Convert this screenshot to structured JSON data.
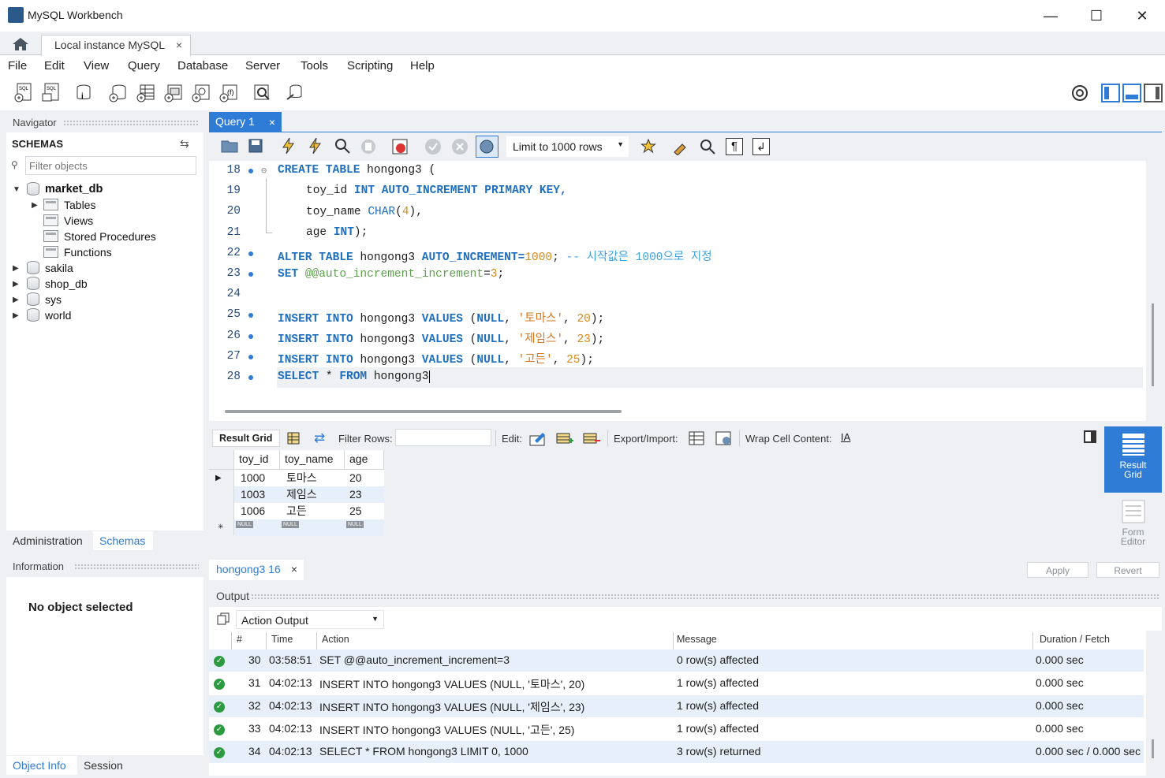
{
  "window": {
    "title": "MySQL Workbench",
    "minimize": "—",
    "maximize": "☐",
    "close": "✕"
  },
  "connection_tab": {
    "label": "Local instance MySQL",
    "close": "×"
  },
  "menu": [
    "File",
    "Edit",
    "View",
    "Query",
    "Database",
    "Server",
    "Tools",
    "Scripting",
    "Help"
  ],
  "navigator": {
    "title": "Navigator",
    "schemas_label": "SCHEMAS",
    "filter_placeholder": "Filter objects",
    "tree": {
      "db": "market_db",
      "children": [
        "Tables",
        "Views",
        "Stored Procedures",
        "Functions"
      ],
      "others": [
        "sakila",
        "shop_db",
        "sys",
        "world"
      ]
    },
    "tabs": [
      "Administration",
      "Schemas"
    ],
    "info_title": "Information",
    "no_object": "No object selected",
    "bottom_tabs": [
      "Object Info",
      "Session"
    ]
  },
  "query_tab": {
    "label": "Query 1",
    "close": "×"
  },
  "query_toolbar": {
    "limit": "Limit to 1000 rows"
  },
  "editor": {
    "lines": [
      {
        "n": "18",
        "dot": true
      },
      {
        "n": "19",
        "dot": false
      },
      {
        "n": "20",
        "dot": false
      },
      {
        "n": "21",
        "dot": false
      },
      {
        "n": "22",
        "dot": true
      },
      {
        "n": "23",
        "dot": true
      },
      {
        "n": "24",
        "dot": false
      },
      {
        "n": "25",
        "dot": true
      },
      {
        "n": "26",
        "dot": true
      },
      {
        "n": "27",
        "dot": true
      },
      {
        "n": "28",
        "dot": true
      }
    ],
    "tokens": {
      "create": "CREATE",
      "table": "TABLE",
      "hongong3": "hongong3",
      "paren_open": "(",
      "toy_id": "toy_id",
      "int": "INT",
      "auto_increment": "AUTO_INCREMENT",
      "primary_key": "PRIMARY KEY,",
      "toy_name": "toy_name",
      "char": "CHAR",
      "char_len": "4",
      "age": "age",
      "int_end": "INT",
      "alter": "ALTER",
      "auto_incr_eq": "AUTO_INCREMENT=",
      "start_val": "1000",
      "comment": "-- 시작값은 1000으로 지정",
      "set": "SET",
      "sysvar": "@@auto_increment_increment",
      "incr_val": "3",
      "insert": "INSERT",
      "into": "INTO",
      "values": "VALUES",
      "null": "NULL",
      "name1": "'토마스'",
      "age1": "20",
      "name2": "'제임스'",
      "age2": "23",
      "name3": "'고든'",
      "age3": "25",
      "select": "SELECT",
      "star": "*",
      "from": "FROM"
    }
  },
  "result_toolbar": {
    "result_grid": "Result Grid",
    "filter_rows": "Filter Rows:",
    "edit": "Edit:",
    "export_import": "Export/Import:",
    "wrap": "Wrap Cell Content:"
  },
  "grid": {
    "columns": [
      "toy_id",
      "toy_name",
      "age"
    ],
    "rows": [
      [
        "1000",
        "토마스",
        "20"
      ],
      [
        "1003",
        "제임스",
        "23"
      ],
      [
        "1006",
        "고든",
        "25"
      ]
    ],
    "null_label": "NULL"
  },
  "side_panel": {
    "result_grid": "Result Grid",
    "form_editor": "Form Editor"
  },
  "result_tab": {
    "label": "hongong3 16",
    "close": "×",
    "apply": "Apply",
    "revert": "Revert"
  },
  "output": {
    "title": "Output",
    "selector": "Action Output",
    "columns": [
      "#",
      "Time",
      "Action",
      "Message",
      "Duration / Fetch"
    ],
    "rows": [
      {
        "n": "30",
        "time": "03:58:51",
        "action": "SET @@auto_increment_increment=3",
        "message": "0 row(s) affected",
        "duration": "0.000 sec"
      },
      {
        "n": "31",
        "time": "04:02:13",
        "action": "INSERT INTO hongong3 VALUES (NULL, '토마스', 20)",
        "message": "1 row(s) affected",
        "duration": "0.000 sec"
      },
      {
        "n": "32",
        "time": "04:02:13",
        "action": "INSERT INTO hongong3 VALUES (NULL, '제임스', 23)",
        "message": "1 row(s) affected",
        "duration": "0.000 sec"
      },
      {
        "n": "33",
        "time": "04:02:13",
        "action": "INSERT INTO hongong3 VALUES (NULL, '고든', 25)",
        "message": "1 row(s) affected",
        "duration": "0.000 sec"
      },
      {
        "n": "34",
        "time": "04:02:13",
        "action": "SELECT * FROM hongong3 LIMIT 0, 1000",
        "message": "3 row(s) returned",
        "duration": "0.000 sec / 0.000 sec"
      }
    ]
  },
  "colors": {
    "accent": "#2f7cd6",
    "keyword": "#1f6fbf",
    "number": "#d68a1f",
    "success": "#2c9a3e"
  }
}
